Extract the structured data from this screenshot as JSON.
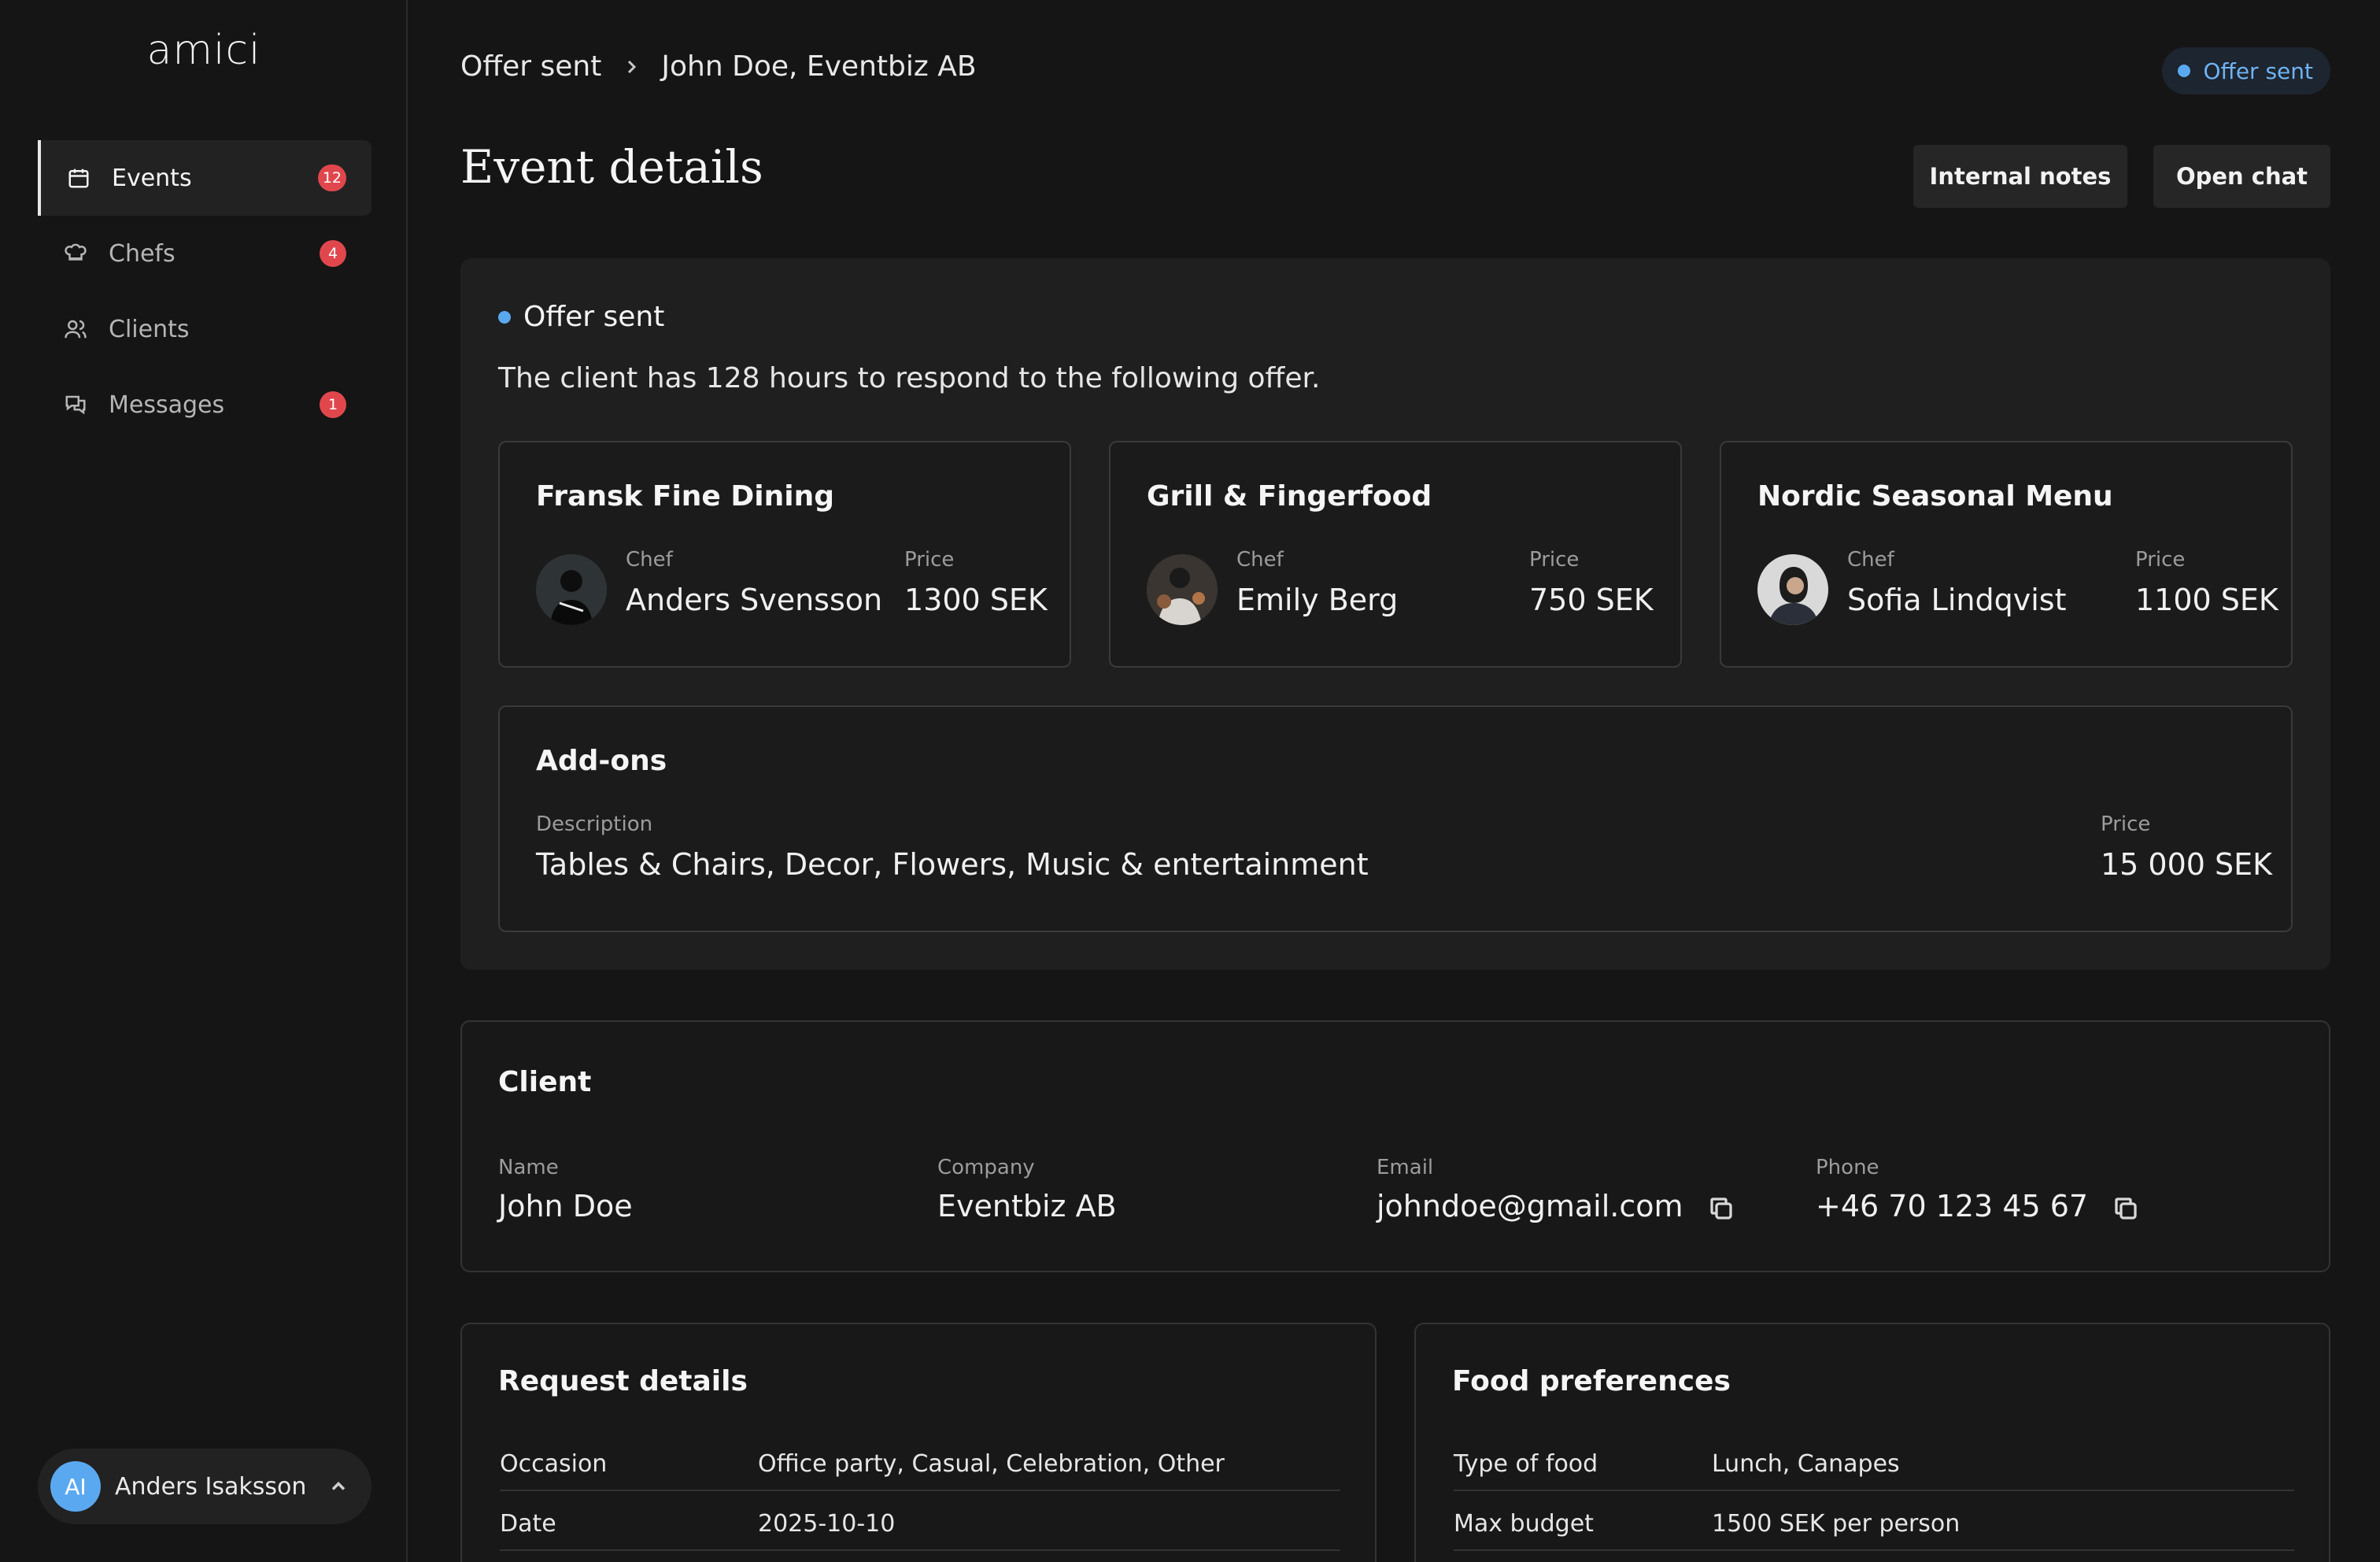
{
  "app": {
    "logo": "amici"
  },
  "sidebar": {
    "items": [
      {
        "label": "Events",
        "badge": "12",
        "icon": "calendar-icon"
      },
      {
        "label": "Chefs",
        "badge": "4",
        "icon": "chef-hat-icon"
      },
      {
        "label": "Clients",
        "badge": "",
        "icon": "users-icon"
      },
      {
        "label": "Messages",
        "badge": "1",
        "icon": "chat-icon"
      }
    ],
    "user": {
      "initials": "AI",
      "name": "Anders Isaksson"
    }
  },
  "header": {
    "breadcrumb": [
      "Offer sent",
      "John Doe, Eventbiz AB"
    ],
    "status": "Offer sent",
    "title": "Event details",
    "buttons": {
      "notes": "Internal notes",
      "chat": "Open chat"
    }
  },
  "offer": {
    "status": "Offer sent",
    "description": "The client has 128 hours to respond to the following offer.",
    "chef_label": "Chef",
    "price_label": "Price",
    "menus": [
      {
        "title": "Fransk Fine Dining",
        "chef": "Anders Svensson",
        "price": "1300 SEK"
      },
      {
        "title": "Grill & Fingerfood",
        "chef": "Emily Berg",
        "price": "750 SEK"
      },
      {
        "title": "Nordic Seasonal Menu",
        "chef": "Sofia Lindqvist",
        "price": "1100 SEK"
      }
    ],
    "addons": {
      "title": "Add-ons",
      "description_label": "Description",
      "description": "Tables & Chairs, Decor, Flowers, Music & entertainment",
      "price_label": "Price",
      "price": "15 000 SEK"
    }
  },
  "client": {
    "title": "Client",
    "name_label": "Name",
    "name": "John Doe",
    "company_label": "Company",
    "company": "Eventbiz AB",
    "email_label": "Email",
    "email": "johndoe@gmail.com",
    "phone_label": "Phone",
    "phone": "+46 70 123 45 67"
  },
  "request": {
    "title": "Request details",
    "rows": [
      {
        "key": "Occasion",
        "value": "Office party, Casual, Celebration, Other"
      },
      {
        "key": "Date",
        "value": "2025-10-10"
      }
    ]
  },
  "food": {
    "title": "Food preferences",
    "rows": [
      {
        "key": "Type of food",
        "value": "Lunch, Canapes"
      },
      {
        "key": "Max budget",
        "value": "1500 SEK per person"
      }
    ]
  },
  "colors": {
    "accent": "#5aa9f0",
    "badge": "#e0474c",
    "background": "#151515"
  }
}
